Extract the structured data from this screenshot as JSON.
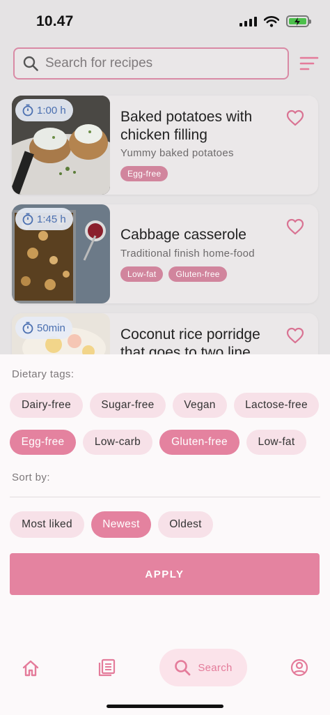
{
  "status_bar": {
    "time": "10.47"
  },
  "search": {
    "placeholder": "Search for recipes"
  },
  "recipes": [
    {
      "time": "1:00 h",
      "title": "Baked potatoes with chicken filling",
      "subtitle": "Yummy baked potatoes",
      "tags": [
        "Egg-free"
      ]
    },
    {
      "time": "1:45 h",
      "title": "Cabbage casserole",
      "subtitle": "Traditional finish home-food",
      "tags": [
        "Low-fat",
        "Gluten-free"
      ]
    },
    {
      "time": "50min",
      "title": "Coconut rice porridge that goes to two line",
      "subtitle": "",
      "tags": []
    }
  ],
  "filters": {
    "dietary_label": "Dietary tags:",
    "dietary_tags": [
      {
        "label": "Dairy-free",
        "selected": false
      },
      {
        "label": "Sugar-free",
        "selected": false
      },
      {
        "label": "Vegan",
        "selected": false
      },
      {
        "label": "Lactose-free",
        "selected": false
      },
      {
        "label": "Egg-free",
        "selected": true
      },
      {
        "label": "Low-carb",
        "selected": false
      },
      {
        "label": "Gluten-free",
        "selected": true
      },
      {
        "label": "Low-fat",
        "selected": false
      }
    ],
    "sort_label": "Sort by:",
    "sort_options": [
      {
        "label": "Most liked",
        "selected": false
      },
      {
        "label": "Newest",
        "selected": true
      },
      {
        "label": "Oldest",
        "selected": false
      }
    ],
    "apply_label": "APPLY"
  },
  "nav": {
    "items": [
      {
        "icon": "home-icon"
      },
      {
        "icon": "recipes-list-icon"
      },
      {
        "icon": "search-icon",
        "label": "Search",
        "active": true
      },
      {
        "icon": "profile-icon"
      }
    ]
  },
  "colors": {
    "accent": "#e4829f",
    "tag": "#d1859d",
    "chip_bg": "#f7e1e8",
    "time_chip_text": "#4a6fb0"
  }
}
